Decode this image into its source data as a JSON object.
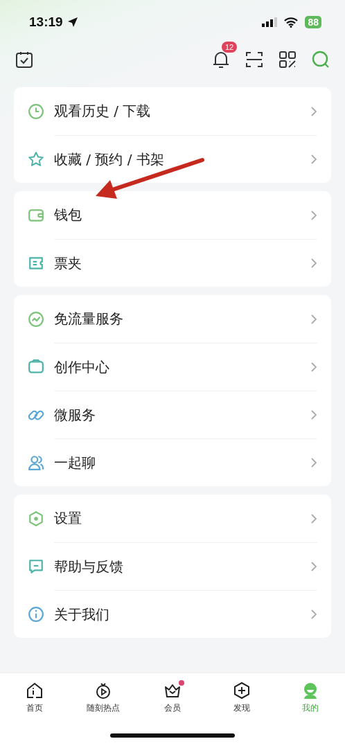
{
  "status_bar": {
    "time": "13:19",
    "battery": "88"
  },
  "top_bar": {
    "notification_count": "12"
  },
  "menu_groups": [
    {
      "items": [
        {
          "label": "观看历史 / 下载"
        },
        {
          "label": "收藏 / 预约 / 书架"
        }
      ]
    },
    {
      "items": [
        {
          "label": "钱包"
        },
        {
          "label": "票夹"
        }
      ]
    },
    {
      "items": [
        {
          "label": "免流量服务"
        },
        {
          "label": "创作中心"
        },
        {
          "label": "微服务"
        },
        {
          "label": "一起聊"
        }
      ]
    },
    {
      "items": [
        {
          "label": "设置"
        },
        {
          "label": "帮助与反馈"
        },
        {
          "label": "关于我们"
        }
      ]
    }
  ],
  "tab_bar": [
    {
      "label": "首页",
      "selected": false,
      "dot": false
    },
    {
      "label": "随刻热点",
      "selected": false,
      "dot": false
    },
    {
      "label": "会员",
      "selected": false,
      "dot": true
    },
    {
      "label": "发现",
      "selected": false,
      "dot": false
    },
    {
      "label": "我的",
      "selected": true,
      "dot": false
    }
  ]
}
